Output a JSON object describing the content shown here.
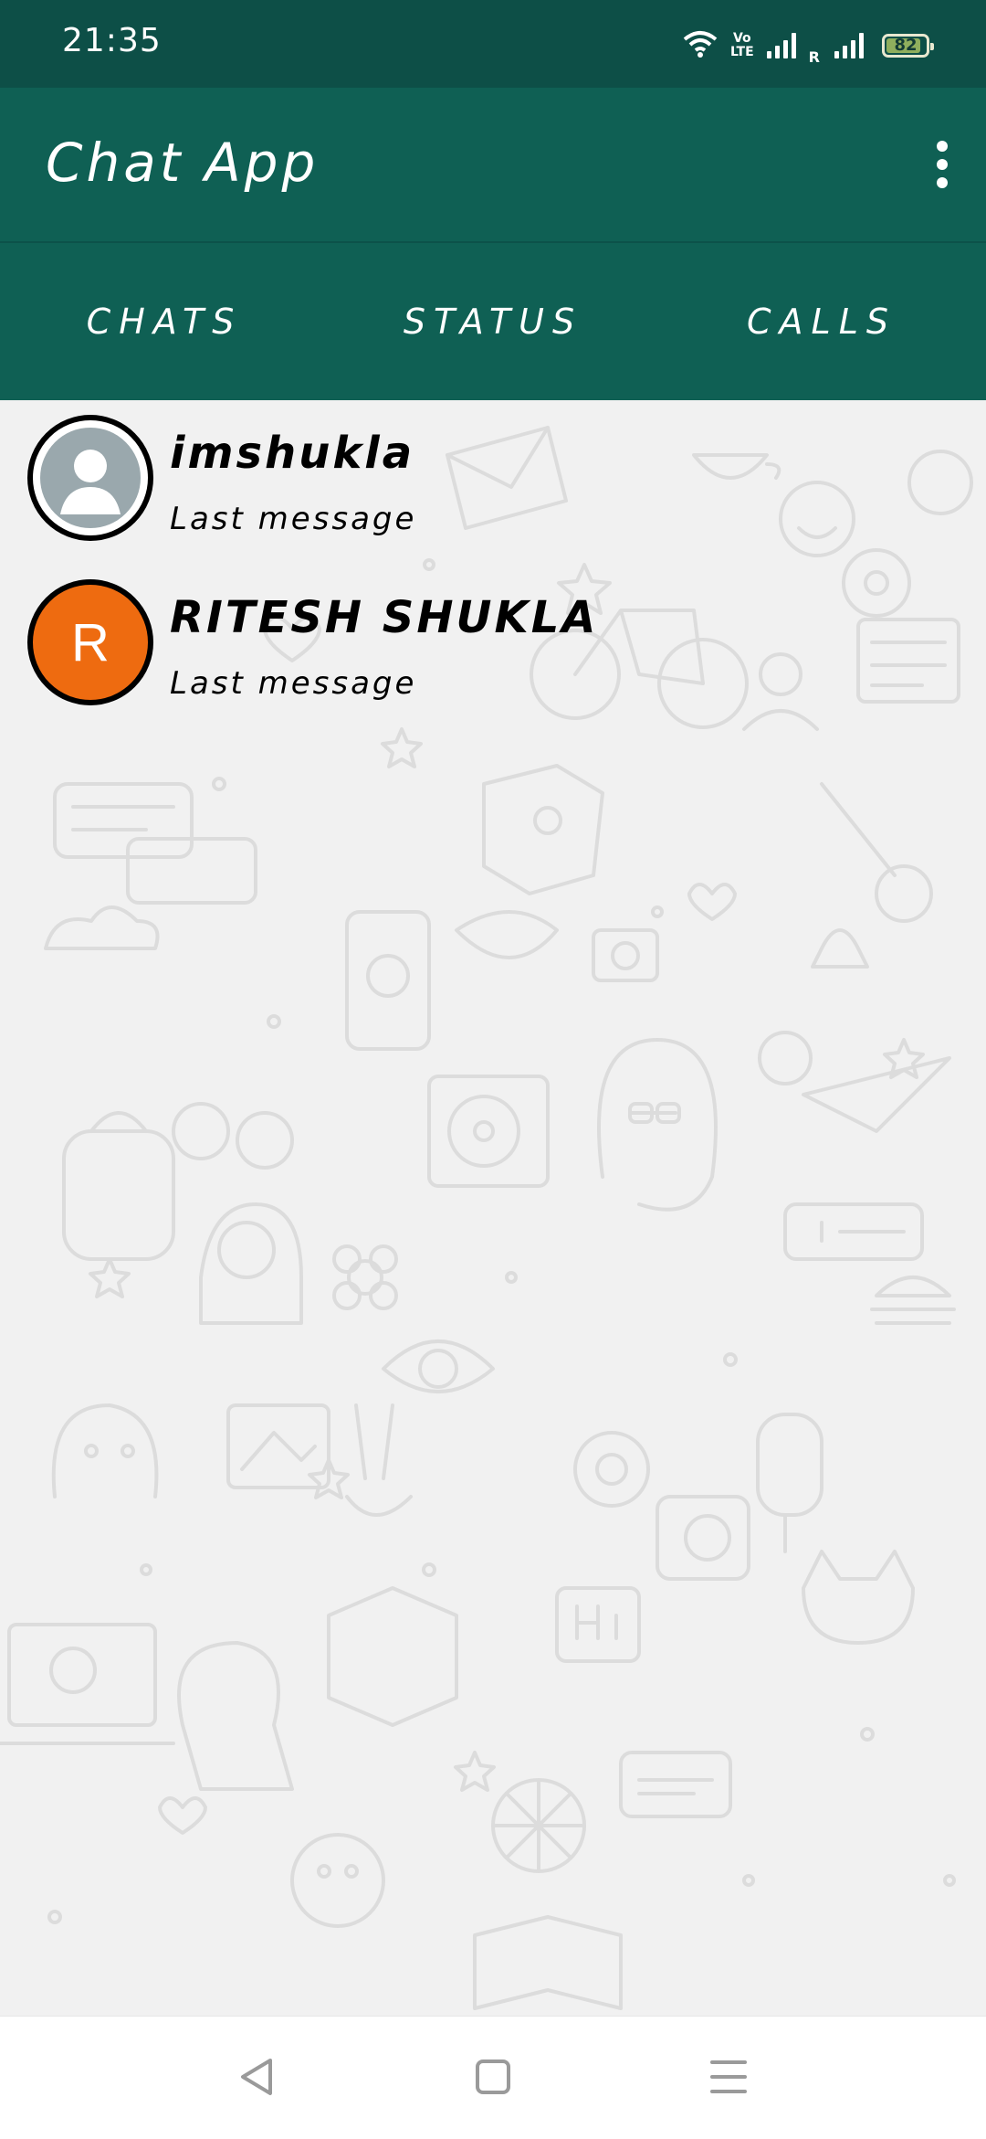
{
  "status_bar": {
    "time": "21:35",
    "volte_line1": "Vo",
    "volte_line2": "LTE",
    "roaming_label": "R",
    "battery_level": "82"
  },
  "app_bar": {
    "title": "Chat App",
    "overflow_icon": "more-vert-icon"
  },
  "tabs": [
    {
      "label": "CHATS"
    },
    {
      "label": "STATUS"
    },
    {
      "label": "CALLS"
    }
  ],
  "chats": [
    {
      "name": "imshukla",
      "last_message": "Last message",
      "avatar": "default-person-icon"
    },
    {
      "name": "RITESH SHUKLA",
      "last_message": "Last message",
      "avatar_letter": "R",
      "avatar_color": "#ee6b10"
    }
  ],
  "colors": {
    "status_bar": "#0d4f47",
    "app_bar": "#0f6054",
    "background": "#f1f1f1"
  },
  "nav_bar": {
    "back_icon": "back-triangle-icon",
    "home_icon": "home-square-icon",
    "menu_icon": "menu-lines-icon"
  }
}
